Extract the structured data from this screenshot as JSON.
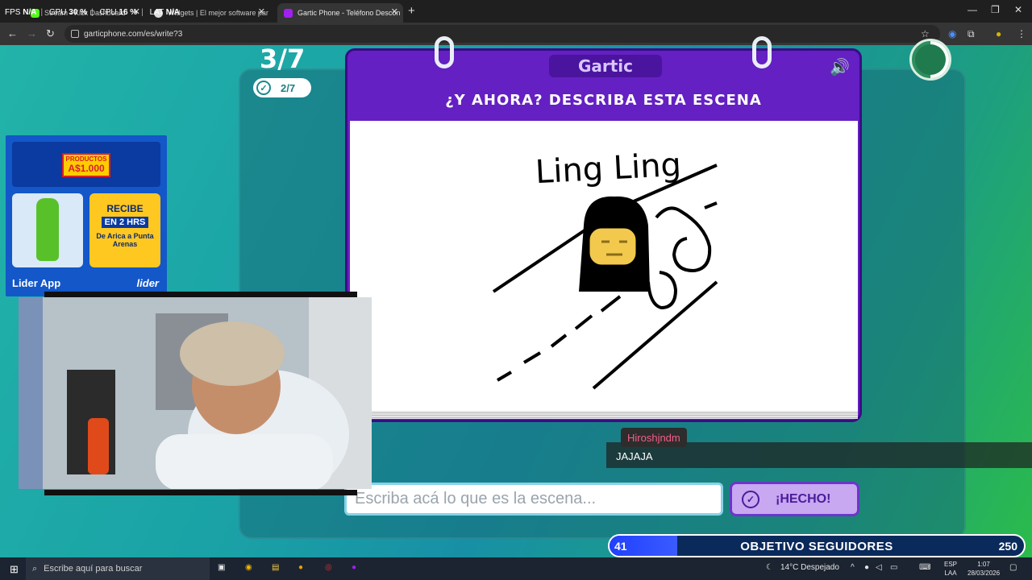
{
  "browser": {
    "tabs": [
      {
        "label": "Stream - Kick Dashboard"
      },
      {
        "label": "Widgets | El mejor software par"
      },
      {
        "label": "Gartic Phone - Teléfono Descon"
      }
    ],
    "new_tab": "+",
    "url": "garticphone.com/es/write?3",
    "perf": {
      "fps_label": "FPS",
      "fps": "N/A",
      "gpu_label": "GPU",
      "gpu": "30 %",
      "cpu_label": "CPU",
      "cpu": "16 %",
      "lat_label": "LAT",
      "lat": "N/A"
    }
  },
  "game": {
    "round": "3/7",
    "sub_round": "2/7",
    "logo": "Gartic",
    "title": "¿Y AHORA? DESCRIBA ESTA ESCENA",
    "drawing_text": "Ling Ling",
    "answer_placeholder": "Escriba acá lo que es la escena...",
    "done_label": "¡HECHO!"
  },
  "chat": {
    "username": "Hiroshjndm",
    "message": "JAJAJA"
  },
  "goal": {
    "current": "41",
    "label": "OBJETIVO SEGUIDORES",
    "target": "250",
    "progress_fraction": 0.164
  },
  "ad": {
    "tag_line": "PRODUCTOS",
    "tag_price": "A$1.000",
    "promo_a": "RECIBE",
    "promo_b": "EN 2 HRS",
    "promo_c": "De Arica a Punta Arenas",
    "brand_left": "Lider App",
    "brand_right": "lider"
  },
  "taskbar": {
    "search_placeholder": "Escribe aquí para buscar",
    "weather": "14°C  Despejado",
    "lang_1": "ESP",
    "lang_2": "LAA",
    "time": "1:07",
    "date": "28/03/2026"
  }
}
